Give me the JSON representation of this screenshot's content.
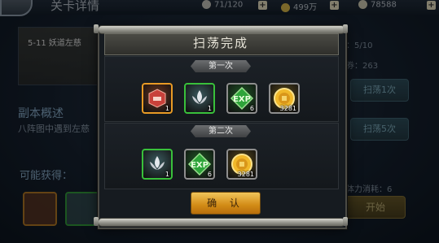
{
  "screen": {
    "title": "关卡详情",
    "stamina": "71/120",
    "coins": "499万",
    "gems": "78588",
    "stage_name": "5-11 妖道左慈",
    "overview_title": "副本概述",
    "overview_text": "八阵图中遇到左慈",
    "drops_title": "可能获得：",
    "sweep_count": "：5/10",
    "sweep_ticket": "券：263",
    "sweep_once_label": "扫荡1次",
    "sweep_five_label": "扫荡5次",
    "stamina_cost": "体力消耗：6",
    "start_label": "开始"
  },
  "dialog": {
    "title": "扫荡完成",
    "confirm_label": "确 认",
    "rounds": [
      {
        "label": "第一次",
        "items": [
          {
            "icon": "red-tile-icon",
            "count": "1",
            "border": "#e89a25",
            "bg": "#6a3520"
          },
          {
            "icon": "silver-lotus-icon",
            "count": "1",
            "border": "#39c03b",
            "bg": "#3b5a5e"
          },
          {
            "icon": "exp-gem-icon",
            "count": "6",
            "border": "#8e8e8e",
            "bg": "#1f5a26"
          },
          {
            "icon": "gold-coin-icon",
            "count": "3281",
            "border": "#8e8e8e",
            "bg": "#5a4a1a"
          }
        ]
      },
      {
        "label": "第二次",
        "items": [
          {
            "icon": "silver-lotus-icon",
            "count": "1",
            "border": "#39c03b",
            "bg": "#3b5a5e"
          },
          {
            "icon": "exp-gem-icon",
            "count": "6",
            "border": "#8e8e8e",
            "bg": "#1f5a26"
          },
          {
            "icon": "gold-coin-icon",
            "count": "3281",
            "border": "#8e8e8e",
            "bg": "#5a4a1a"
          }
        ]
      }
    ]
  }
}
